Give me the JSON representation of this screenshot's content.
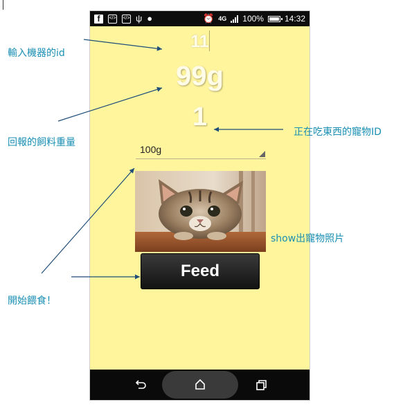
{
  "app": {
    "device_id": "11",
    "reported_weight": "99g",
    "eating_pet_id": "1",
    "amount_dropdown": {
      "selected": "100g"
    },
    "feed_button_label": "Feed"
  },
  "status_bar": {
    "battery_percent": "100%",
    "time": "14:32",
    "network": "4G",
    "left_icons": [
      "facebook-icon",
      "code-icon",
      "code-icon",
      "usb-icon",
      "android-icon"
    ],
    "right_icons": [
      "alarm-icon",
      "network-4g-icon",
      "signal-icon",
      "battery-icon"
    ]
  },
  "nav_bar": {
    "buttons": [
      "back-icon",
      "home-icon",
      "recents-icon"
    ]
  },
  "annotations": {
    "input_id": "輸入機器的id",
    "returned_weight": "回報的飼料重量",
    "eating_pet_id": "正在吃東西的寵物ID",
    "show_pet_photo": "show出寵物照片",
    "start_feeding": "開始餵食！"
  },
  "colors": {
    "app_background": "#fff59d",
    "annotation": "#1a8fb3",
    "arrow": "#1f4e79",
    "button": "#1e1e1e"
  }
}
